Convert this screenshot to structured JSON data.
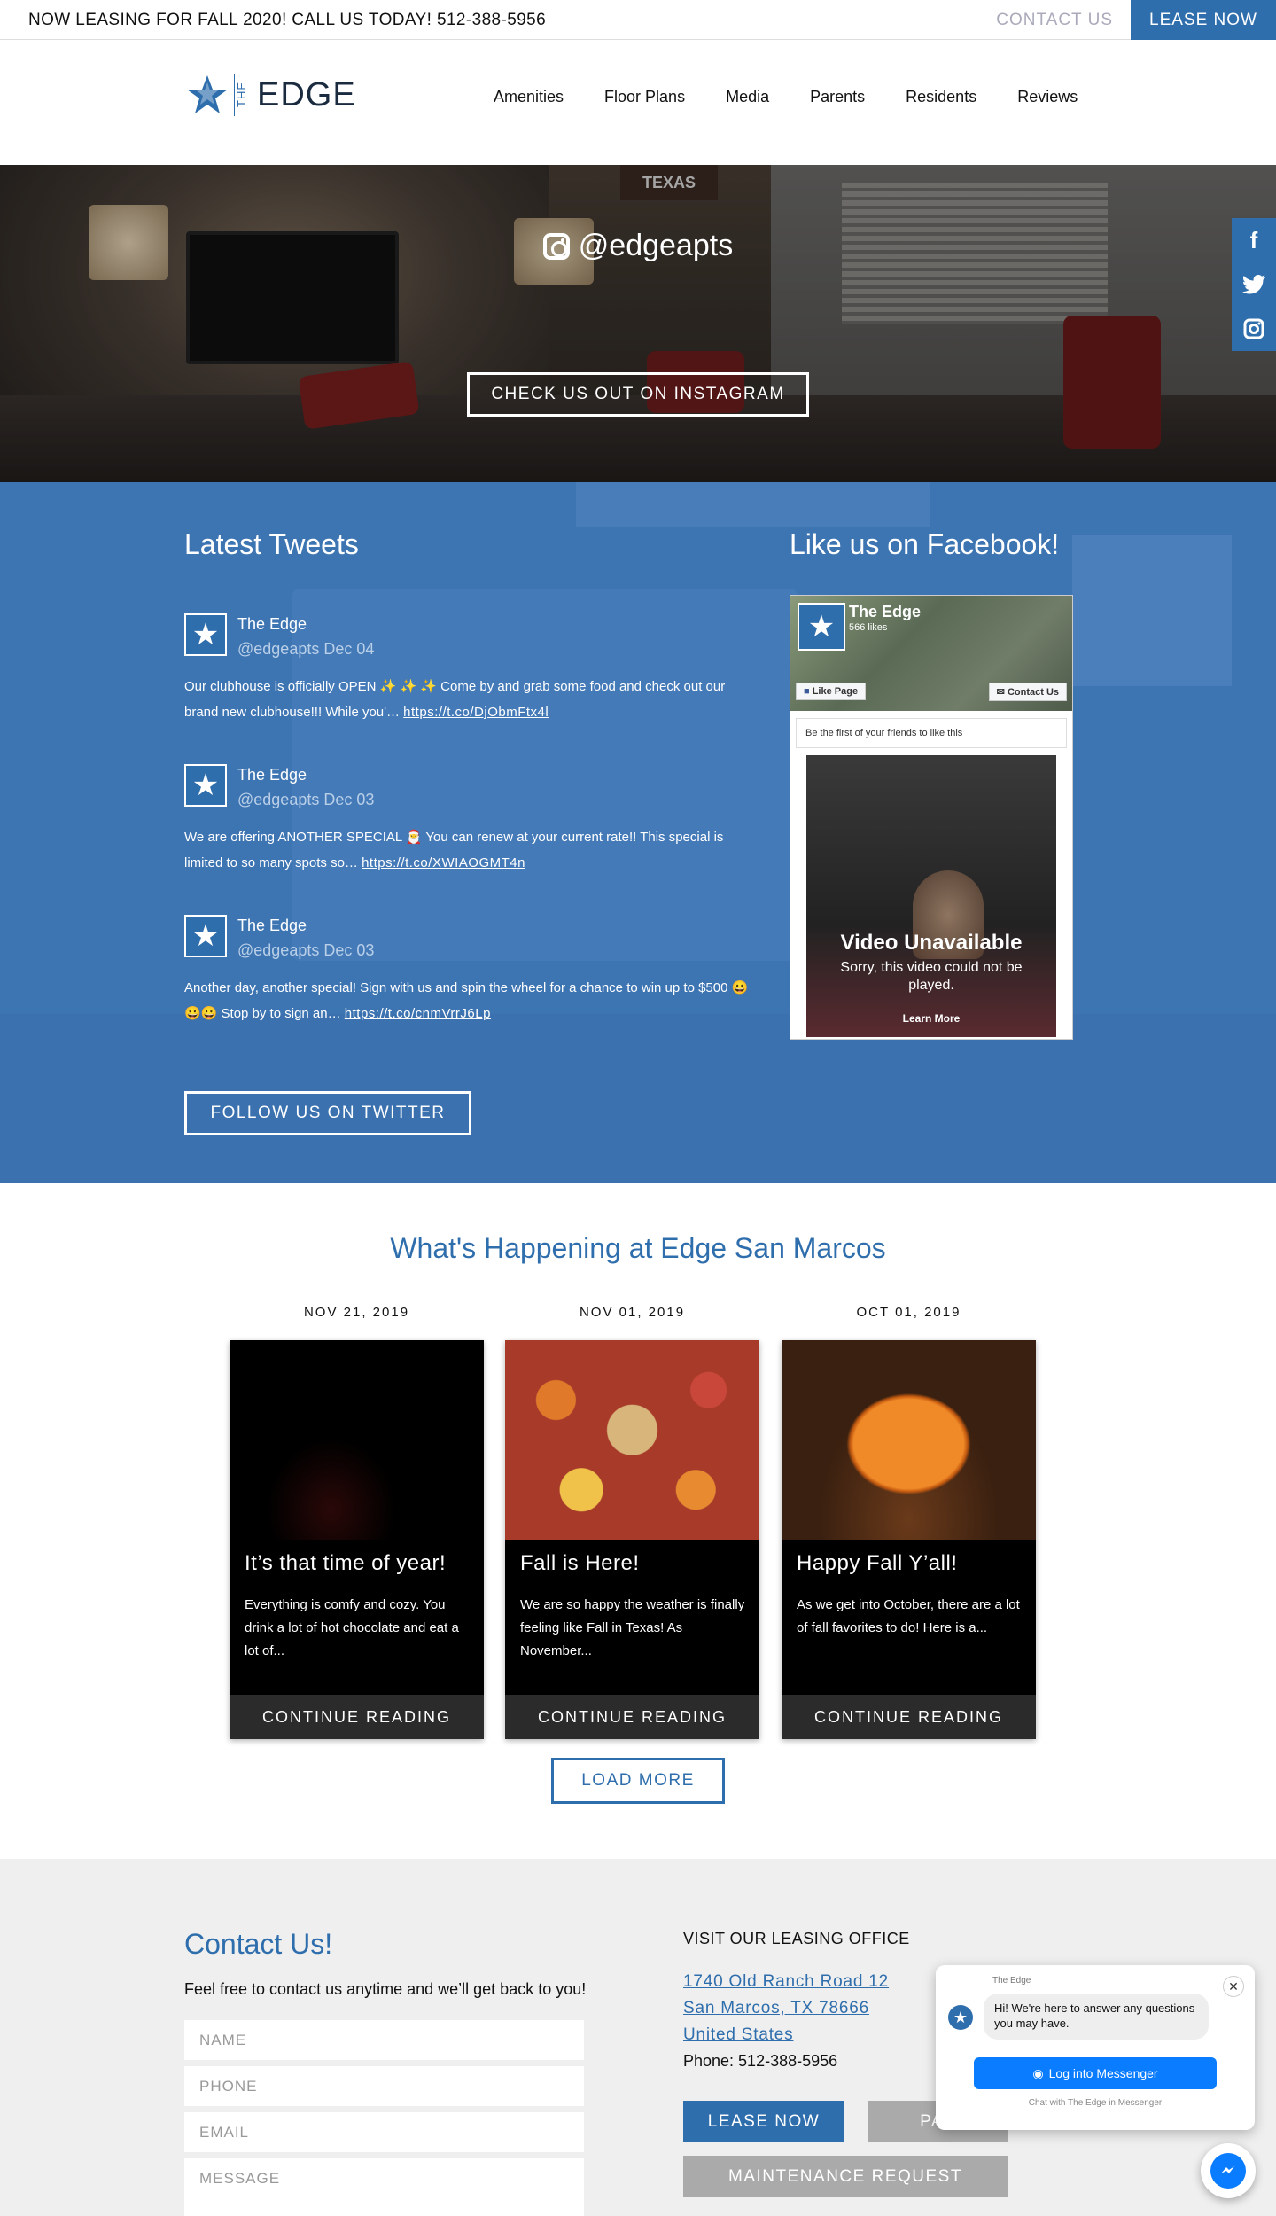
{
  "topbar": {
    "promo": "NOW LEASING FOR FALL 2020! CALL US TODAY! 512-388-5956",
    "contact_label": "CONTACT US",
    "lease_label": "LEASE NOW"
  },
  "header": {
    "logo_the": "THE",
    "logo_edge": "EDGE",
    "nav": [
      "Amenities",
      "Floor Plans",
      "Media",
      "Parents",
      "Residents",
      "Reviews"
    ],
    "active_nav": "Media"
  },
  "instagram": {
    "handle": "@edgeapts",
    "button_label": "CHECK US OUT ON INSTAGRAM",
    "hero_sign": "TEXAS"
  },
  "social_sidebar": {
    "items": [
      {
        "icon": "facebook-icon",
        "glyph": "f"
      },
      {
        "icon": "twitter-icon",
        "glyph": "t"
      },
      {
        "icon": "instagram-icon",
        "glyph": "◎"
      }
    ]
  },
  "tweets": {
    "heading": "Latest Tweets",
    "items": [
      {
        "name": "The Edge",
        "handle": "@edgeapts",
        "date": "Dec 04",
        "text": "Our clubhouse is officially OPEN ✨ ✨ ✨ Come by and grab some food and check out our brand new clubhouse!!! While you'… ",
        "link": "https://t.co/DjObmFtx4l"
      },
      {
        "name": "The Edge",
        "handle": "@edgeapts",
        "date": "Dec 03",
        "text": "We are offering ANOTHER SPECIAL 🎅 You can renew at your current rate!! This special is limited to so many spots so… ",
        "link": "https://t.co/XWIAOGMT4n"
      },
      {
        "name": "The Edge",
        "handle": "@edgeapts",
        "date": "Dec 03",
        "text": "Another day, another special! Sign with us and spin the wheel for a chance to win up to $500 😀😀😀 Stop by to sign an… ",
        "link": "https://t.co/cnmVrrJ6Lp"
      }
    ],
    "follow_label": "FOLLOW US ON TWITTER"
  },
  "facebook": {
    "heading": "Like us on Facebook!",
    "page_name": "The Edge",
    "likes": "566 likes",
    "like_button": "Like Page",
    "contact_button": "Contact Us",
    "friends_text": "Be the first of your friends to like this",
    "video_title": "Video Unavailable",
    "video_subtitle": "Sorry, this video could not be played.",
    "video_link": "Learn More"
  },
  "happening": {
    "title": "What's Happening at Edge San Marcos",
    "posts": [
      {
        "date": "NOV 21, 2019",
        "title": "It’s that time of year!",
        "excerpt": "Everything is comfy and cozy. You drink a lot of hot chocolate and eat a lot of...",
        "cta": "CONTINUE READING"
      },
      {
        "date": "NOV 01, 2019",
        "title": "Fall is Here!",
        "excerpt": "We are so happy the weather is finally feeling like Fall in Texas! As November...",
        "cta": "CONTINUE READING"
      },
      {
        "date": "OCT 01, 2019",
        "title": "Happy Fall Y’all!",
        "excerpt": "As we get into October, there are a lot of fall favorites to do! Here is a...",
        "cta": "CONTINUE READING"
      }
    ],
    "load_more": "LOAD MORE"
  },
  "contact": {
    "heading": "Contact Us!",
    "lead": "Feel free to contact us anytime and we’ll get back to you!",
    "fields": {
      "name_placeholder": "NAME",
      "phone_placeholder": "PHONE",
      "email_placeholder": "EMAIL",
      "message_placeholder": "MESSAGE"
    },
    "office_heading": "VISIT OUR LEASING OFFICE",
    "address_line1": "1740 Old Ranch Road 12",
    "address_line2": "San Marcos, TX 78666",
    "address_line3": "United States",
    "phone": "Phone: 512-388-5956",
    "lease_button": "LEASE NOW",
    "pay_button": "PAY",
    "maintenance_button": "MAINTENANCE REQUEST"
  },
  "messenger": {
    "page_name": "The Edge",
    "message": "Hi! We're here to answer any questions you may have.",
    "login_button": "Log into Messenger",
    "footer": "Chat with The Edge in Messenger",
    "close_glyph": "✕"
  },
  "colors": {
    "brand_blue": "#2f6ead",
    "social_section_blue": "#3d74b2",
    "messenger_blue": "#0a7cff",
    "footer_gray": "#efefef"
  }
}
